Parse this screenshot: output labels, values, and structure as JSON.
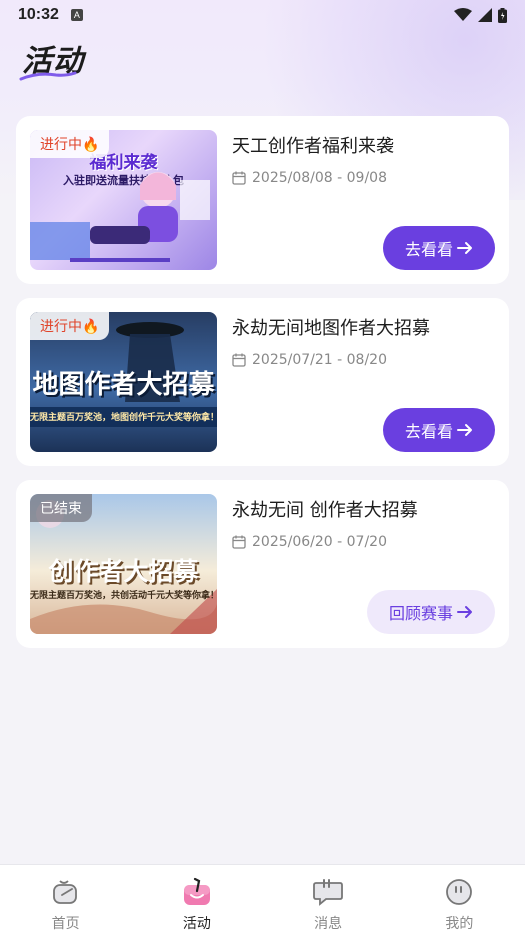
{
  "status_bar": {
    "time": "10:32",
    "a_badge": "A"
  },
  "page": {
    "title": "活动"
  },
  "cards": [
    {
      "status": "进行中🔥",
      "status_type": "ongoing",
      "title": "天工创作者福利来袭",
      "date_range": "2025/08/08 - 09/08",
      "button_label": "去看看",
      "thumb_text": "福利来袭",
      "thumb_subtext": "入驻即送流量扶持大礼包"
    },
    {
      "status": "进行中🔥",
      "status_type": "ongoing",
      "title": "永劫无间地图作者大招募",
      "date_range": "2025/07/21 - 08/20",
      "button_label": "去看看",
      "thumb_text": "地图作者大招募",
      "thumb_subtext": "无限主题百万奖池，地图创作千元大奖等你拿！"
    },
    {
      "status": "已结束",
      "status_type": "ended",
      "title": "永劫无间 创作者大招募",
      "date_range": "2025/06/20 - 07/20",
      "button_label": "回顾赛事",
      "thumb_text": "创作者大招募",
      "thumb_subtext": "无限主题百万奖池，共创活动千元大奖等你拿！"
    }
  ],
  "tab_bar": {
    "items": [
      {
        "label": "首页",
        "icon": "home-icon",
        "active": false
      },
      {
        "label": "活动",
        "icon": "activity-icon",
        "active": true
      },
      {
        "label": "消息",
        "icon": "message-icon",
        "active": false
      },
      {
        "label": "我的",
        "icon": "profile-icon",
        "active": false
      }
    ]
  },
  "colors": {
    "accent": "#6a3fe0",
    "ongoing": "#e0442b",
    "background": "#f4f3f8"
  }
}
